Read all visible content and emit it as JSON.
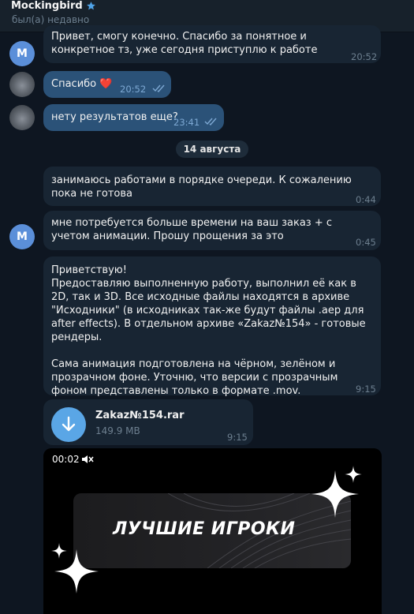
{
  "header": {
    "title": "Mockingbird",
    "status": "был(а) недавно"
  },
  "avatars": {
    "contact_letter": "M"
  },
  "messages": [
    {
      "text": "Привет, смогу конечно. Спасибо за понятное и конкретное тз, уже сегодня приступлю к работе",
      "time": "20:52",
      "direction": "in"
    },
    {
      "text": "Спасибо ❤️",
      "time": "20:52",
      "direction": "out",
      "read": true
    },
    {
      "text": "нету результатов еще?",
      "time": "23:41",
      "direction": "out",
      "read": true
    },
    {
      "text": "занимаюсь работами в порядке очереди. К сожалению пока не готова",
      "time": "0:44",
      "direction": "in"
    },
    {
      "text": "мне потребуется больше времени на ваш заказ + с учетом анимации. Прошу прощения за это",
      "time": "0:45",
      "direction": "in"
    },
    {
      "text": "Приветствую!\nПредоставляю выполненную работу, выполнил её как в 2D, так и 3D. Все исходные файлы находятся в архиве \"Исходники\" (в исходниках так-же будут файлы .aep для after effects). В отдельном архиве «Zakaz№154» - готовые рендеры.\n\nСама анимация подготовлена на чёрном, зелёном и прозрачном фоне. Уточню, что версии с прозрачным фоном представлены только в формате .mov.",
      "time": "9:15",
      "direction": "in"
    }
  ],
  "date_separator": "14 августа",
  "file": {
    "name": "Zakaz№154.rar",
    "size": "149.9 MB",
    "time": "9:15",
    "icon": "download-arrow-icon"
  },
  "video": {
    "time": "00:02",
    "banner_text": "ЛУЧШИЕ ИГРОКИ",
    "icon": "mute-icon"
  },
  "colors": {
    "background": "#0e1621",
    "incoming_bubble": "#182533",
    "outgoing_bubble": "#2b5278",
    "accent": "#5aa6e6"
  }
}
